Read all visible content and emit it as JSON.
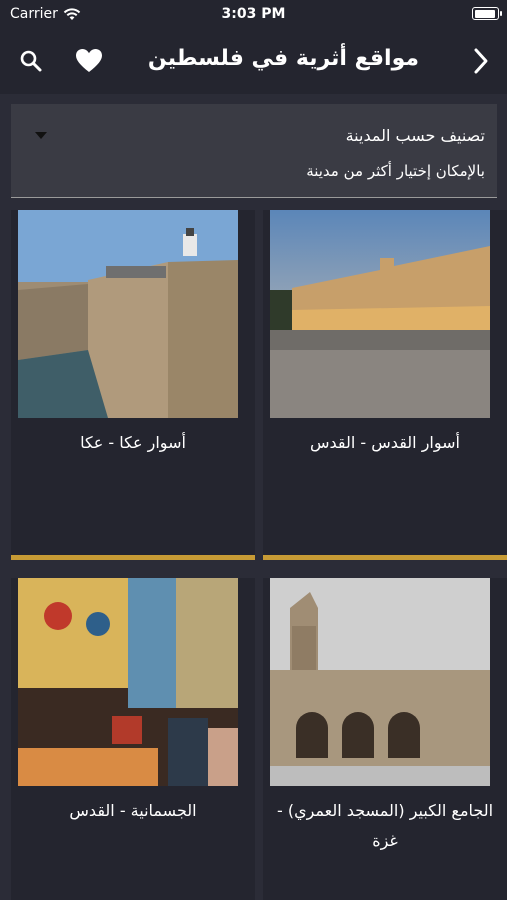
{
  "status": {
    "carrier": "Carrier",
    "time": "3:03 PM"
  },
  "nav": {
    "title": "مواقع أثرية في فلسطين",
    "back_icon": "chevron-right-icon",
    "favorites_icon": "heart-icon",
    "search_icon": "search-icon"
  },
  "filter": {
    "title": "تصنيف حسب المدينة",
    "hint": "بالإمكان إختيار أكثر من مدينة"
  },
  "sites": [
    {
      "caption": "أسوار القدس - القدس"
    },
    {
      "caption": "أسوار عكا - عكا"
    },
    {
      "caption": "الجامع الكبير (المسجد العمري) - غزة"
    },
    {
      "caption": "الجسمانية - القدس"
    }
  ],
  "colors": {
    "background": "#2b2c37",
    "bar": "#24252f",
    "card": "#24252f",
    "accent": "#c79b35",
    "filter": "#3a3b44"
  }
}
